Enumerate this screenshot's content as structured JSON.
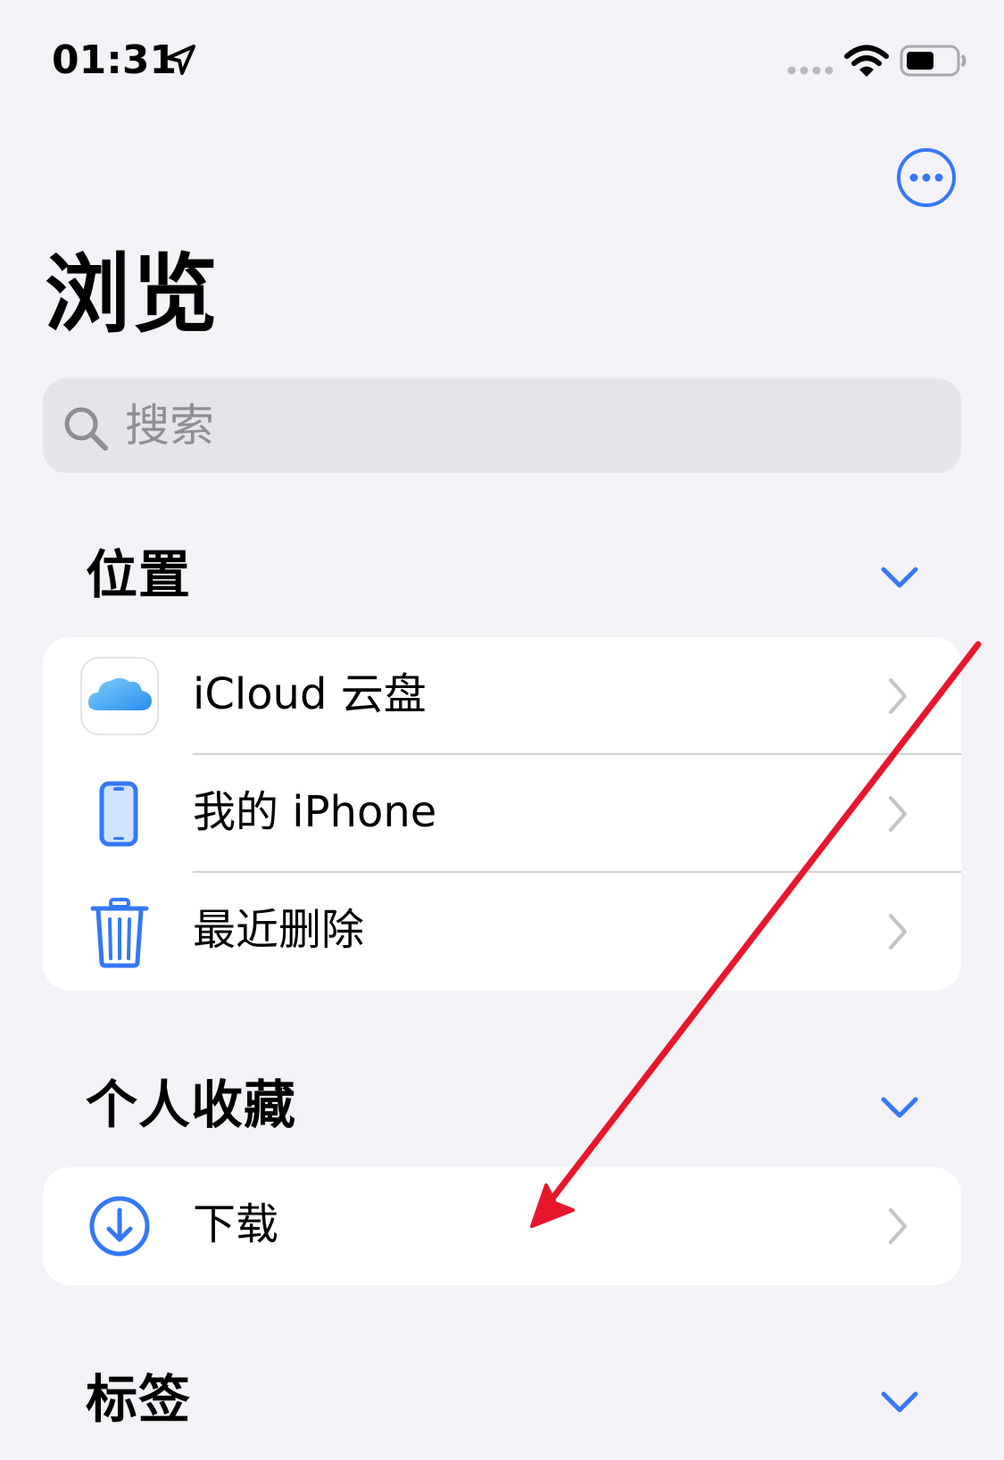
{
  "status_bar": {
    "time": "01:31",
    "icons": [
      "location-arrow-icon",
      "signal-dots-icon",
      "wifi-icon",
      "battery-icon"
    ]
  },
  "nav": {
    "more_icon": "ellipsis-circle-icon"
  },
  "page": {
    "title": "浏览"
  },
  "search": {
    "placeholder": "搜索",
    "icon": "search-icon"
  },
  "sections": {
    "locations": {
      "header": "位置",
      "items": [
        {
          "label": "iCloud 云盘",
          "icon": "icloud-icon"
        },
        {
          "label": "我的 iPhone",
          "icon": "iphone-icon"
        },
        {
          "label": "最近删除",
          "icon": "trash-icon"
        }
      ]
    },
    "favorites": {
      "header": "个人收藏",
      "items": [
        {
          "label": "下载",
          "icon": "download-icon"
        }
      ]
    },
    "tags": {
      "header": "标签"
    }
  },
  "colors": {
    "accent": "#3478f6",
    "background": "#f2f2f7",
    "annotation": "#e8162a"
  },
  "annotation": {
    "icon": "red-arrow-annotation"
  }
}
